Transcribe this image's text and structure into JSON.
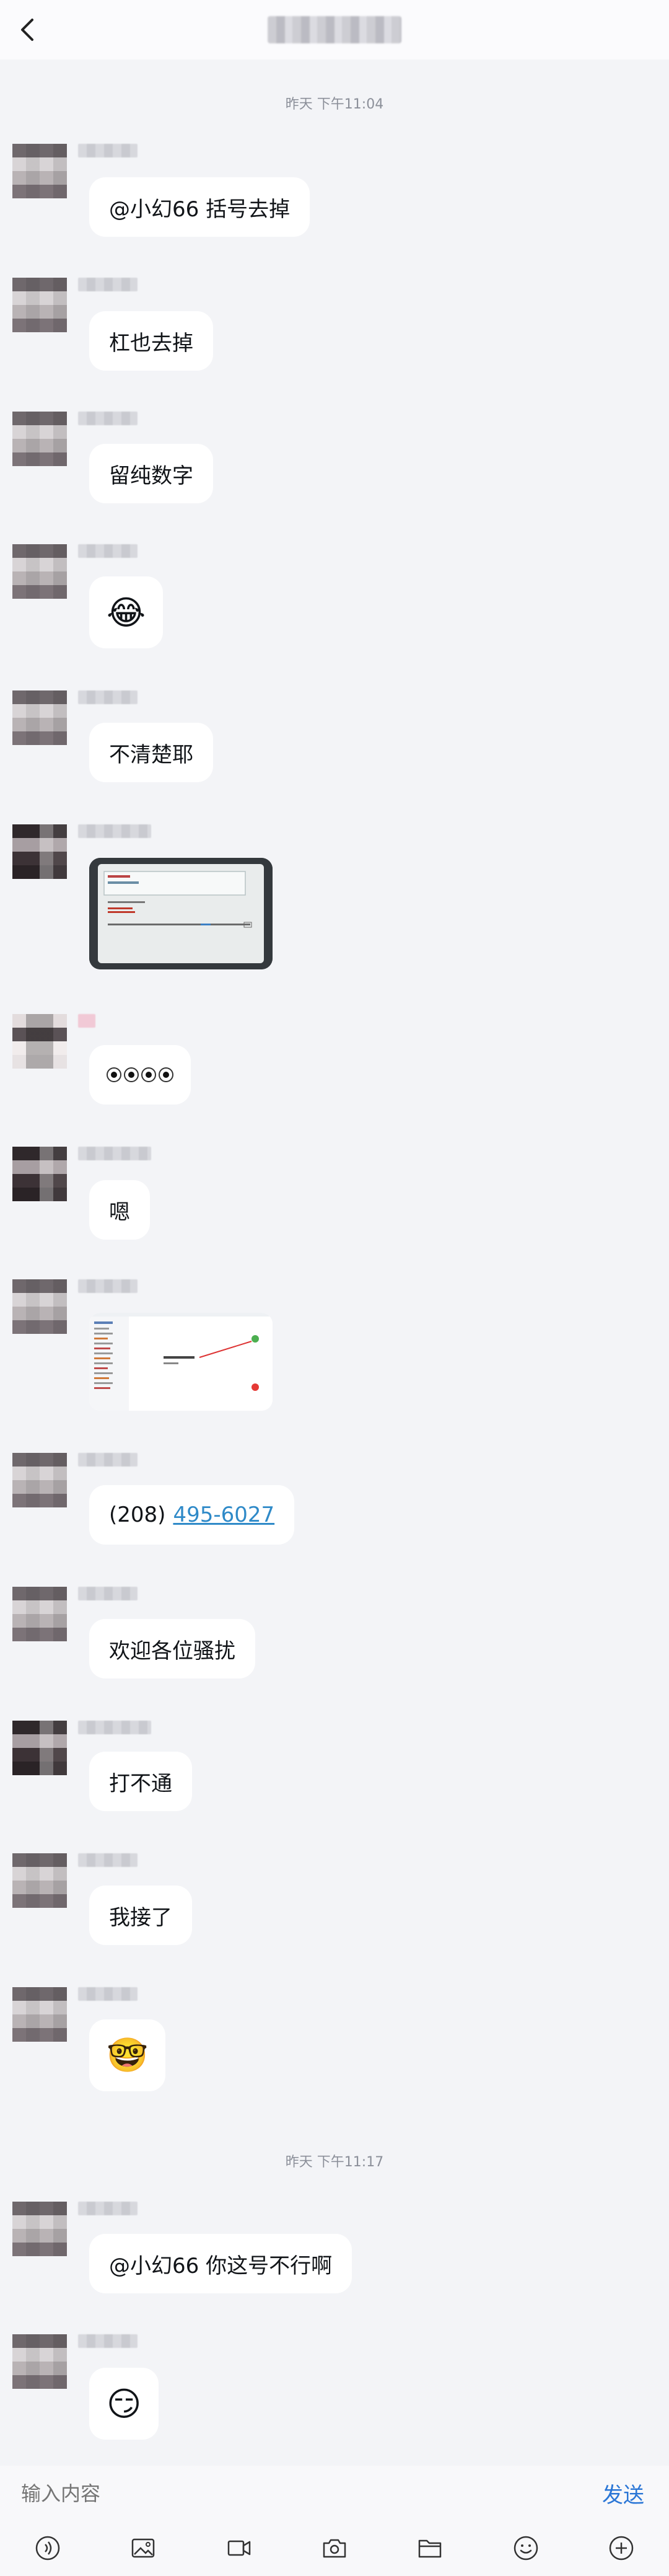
{
  "header": {
    "back_icon": "chevron-left-icon"
  },
  "timestamps": [
    "昨天 下午11:04",
    "昨天 下午11:17"
  ],
  "messages": [
    {
      "type": "text",
      "text": "@小幻66 括号去掉"
    },
    {
      "type": "text",
      "text": "杠也去掉"
    },
    {
      "type": "text",
      "text": "留纯数字"
    },
    {
      "type": "emoji",
      "emoji": "😂"
    },
    {
      "type": "text",
      "text": "不清楚耶"
    },
    {
      "type": "image",
      "icon": "screenshot-image"
    },
    {
      "type": "emoji_eyes",
      "icon": "eyes-emoji"
    },
    {
      "type": "text",
      "text": "嗯"
    },
    {
      "type": "image",
      "icon": "screenshot-image"
    },
    {
      "type": "text",
      "text": "(208)",
      "link": "495-6027"
    },
    {
      "type": "text",
      "text": "欢迎各位骚扰"
    },
    {
      "type": "text",
      "text": "打不通"
    },
    {
      "type": "text",
      "text": "我接了"
    },
    {
      "type": "emoji",
      "emoji": "🤓"
    },
    {
      "type": "text",
      "text": "@小幻66 你这号不行啊"
    },
    {
      "type": "emoji",
      "emoji": "😏"
    }
  ],
  "input": {
    "placeholder": "输入内容",
    "send_label": "发送"
  },
  "toolbar": {
    "icons": [
      "voice-icon",
      "image-icon",
      "video-icon",
      "camera-icon",
      "folder-icon",
      "emoji-icon",
      "plus-icon"
    ]
  }
}
